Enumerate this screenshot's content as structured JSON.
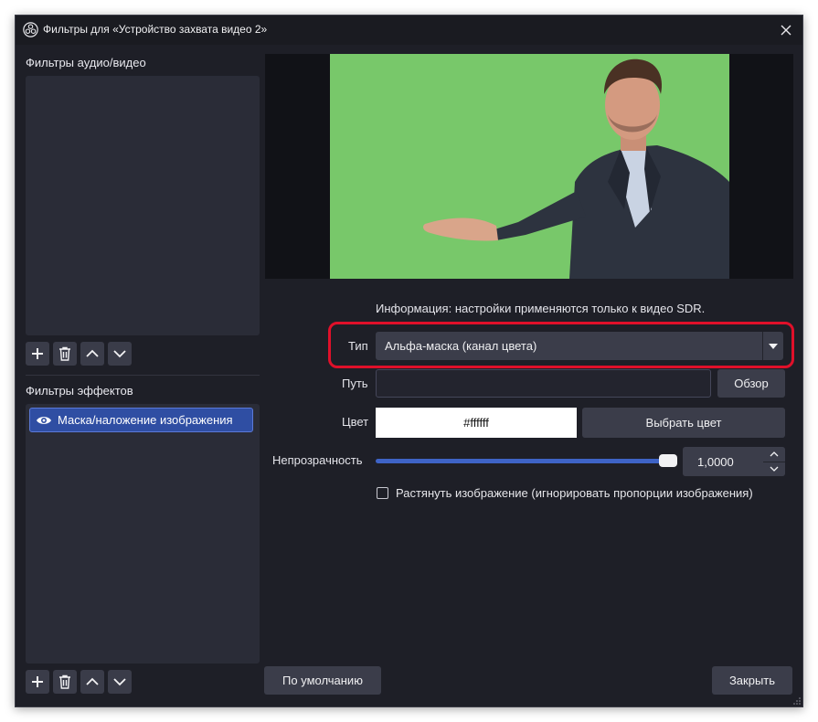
{
  "window": {
    "title": "Фильтры для «Устройство захвата видео 2»"
  },
  "left_panel": {
    "audio_video_label": "Фильтры аудио/видео",
    "effects_label": "Фильтры эффектов",
    "effect_filters": [
      {
        "label": "Маска/наложение изображения",
        "visible": true,
        "selected": true
      }
    ],
    "toolbar_icons": [
      "plus-icon",
      "trash-icon",
      "chevron-up-icon",
      "chevron-down-icon"
    ]
  },
  "settings": {
    "info_text": "Информация: настройки применяются только к видео SDR.",
    "type_label": "Тип",
    "type_value": "Альфа-маска (канал цвета)",
    "path_label": "Путь",
    "path_value": "",
    "browse_label": "Обзор",
    "color_label": "Цвет",
    "color_value": "#ffffff",
    "pick_color_label": "Выбрать цвет",
    "opacity_label": "Непрозрачность",
    "opacity_value": "1,0000",
    "opacity_level": 1.0,
    "stretch_label": "Растянуть изображение (игнорировать пропорции изображения)",
    "stretch_checked": false
  },
  "footer": {
    "defaults_label": "По умолчанию",
    "close_label": "Закрыть"
  },
  "colors": {
    "accent": "#3e63c6",
    "highlight_outline": "#e0102a",
    "chroma_green": "#78c86a"
  }
}
